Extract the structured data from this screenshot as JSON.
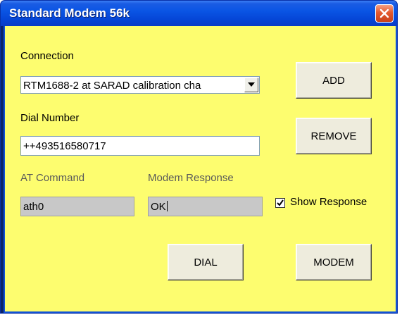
{
  "window": {
    "title": "Standard Modem 56k"
  },
  "connection": {
    "label": "Connection",
    "selected": "RTM1688-2 at SARAD calibration cha"
  },
  "dial_number": {
    "label": "Dial Number",
    "value": "++493516580717"
  },
  "at_command": {
    "label": "AT Command",
    "value": "ath0"
  },
  "modem_response": {
    "label": "Modem Response",
    "value": "OK"
  },
  "show_response": {
    "label": "Show Response",
    "checked": true
  },
  "buttons": {
    "add": "ADD",
    "remove": "REMOVE",
    "dial": "DIAL",
    "modem": "MODEM"
  },
  "colors": {
    "client_background": "#fdfd6f",
    "title_bar": "#0a55e4",
    "close_button": "#e45a2f"
  }
}
